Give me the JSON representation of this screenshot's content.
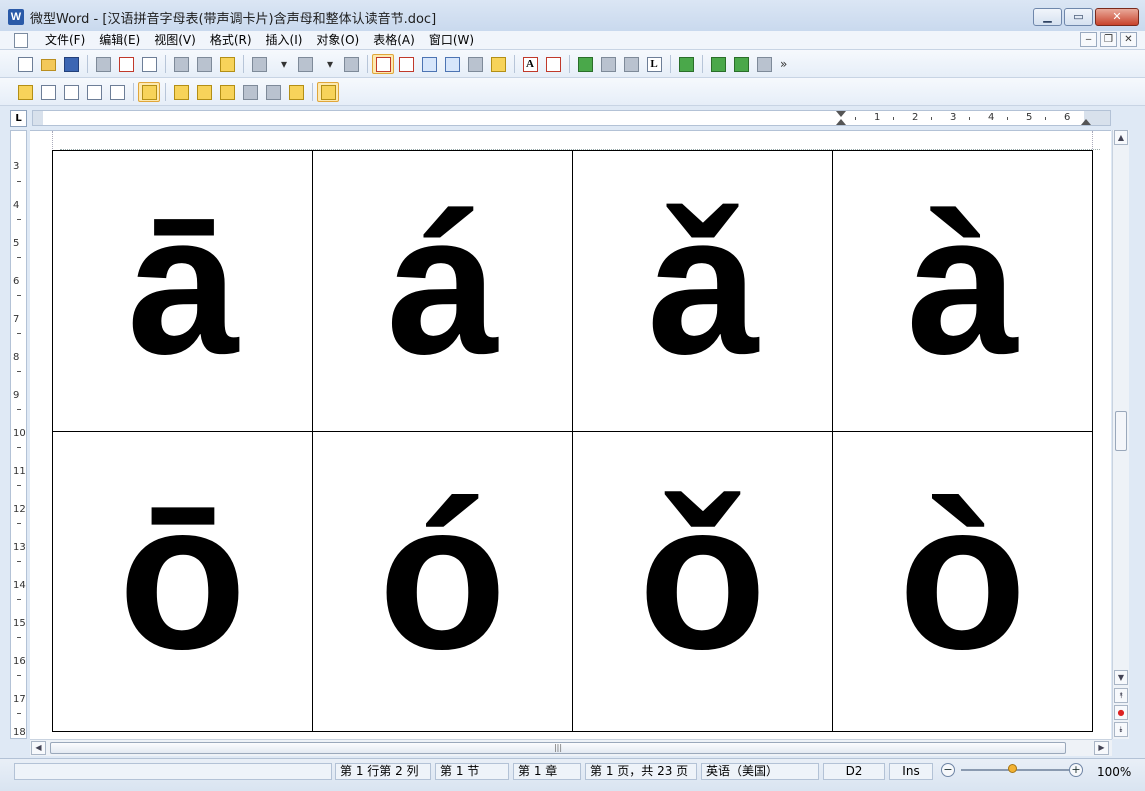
{
  "window": {
    "title": "微型Word - [汉语拼音字母表(带声调卡片)含声母和整体认读音节.doc]",
    "app_icon_letter": "W",
    "minimize": "▁",
    "maximize": "▭",
    "close": "✕"
  },
  "menu": {
    "items": [
      "文件(F)",
      "编辑(E)",
      "视图(V)",
      "格式(R)",
      "插入(I)",
      "对象(O)",
      "表格(A)",
      "窗口(W)"
    ],
    "mdi_min": "‒",
    "mdi_restore": "❐",
    "mdi_close": "✕"
  },
  "toolbar1": {
    "overflow": "»"
  },
  "ruler": {
    "corner": "L",
    "h_numbers": [
      "1",
      "2",
      "3",
      "4",
      "5",
      "6"
    ],
    "v_numbers": [
      "3",
      "4",
      "5",
      "6",
      "7",
      "8",
      "9",
      "10",
      "11",
      "12",
      "13",
      "14",
      "15",
      "16",
      "17",
      "18"
    ]
  },
  "document": {
    "cards": [
      [
        "ā",
        "á",
        "ǎ",
        "à"
      ],
      [
        "ō",
        "ó",
        "ǒ",
        "ò"
      ]
    ]
  },
  "scrollbar": {
    "up": "▲",
    "down": "▼",
    "left": "◀",
    "right": "▶",
    "prev_page": "⯭",
    "browse": "●",
    "next_page": "⯯",
    "grip": "|||"
  },
  "statusbar": {
    "position": "第 1 行第 2 列",
    "section": "第 1 节",
    "chapter": "第 1 章",
    "page": "第 1 页，共 23 页",
    "language": "英语（美国）",
    "style": "D2",
    "mode": "Ins",
    "zoom": "100%",
    "zoom_level_percent": 100,
    "zoom_minus": "−",
    "zoom_plus": "+"
  },
  "colors": {
    "titlebar": "#dbe6f4",
    "toolbar": "#e6eef8",
    "close_button": "#c8432c",
    "active_button": "#fde9b0"
  }
}
